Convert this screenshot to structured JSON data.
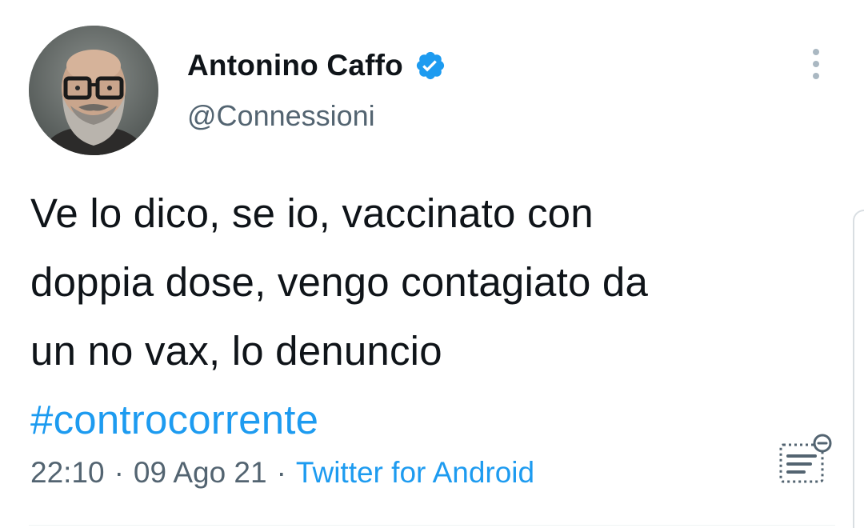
{
  "author": {
    "display_name": "Antonino Caffo",
    "handle": "@Connessioni",
    "verified": true,
    "avatar_icon": "bearded-man-with-glasses-avatar"
  },
  "tweet": {
    "text_lines": [
      "Ve lo dico, se io, vaccinato con",
      "doppia dose, vengo contagiato da",
      "un no vax, lo denuncio"
    ],
    "hashtag": "#controcorrente"
  },
  "meta": {
    "time": "22:10",
    "separator": "·",
    "date": "09 Ago 21",
    "source": "Twitter for Android"
  },
  "icons": {
    "verified": "verified-badge-icon",
    "more": "more-options-icon",
    "analytics": "tweet-analytics-icon"
  },
  "colors": {
    "link": "#1d9bf0",
    "secondary_text": "#536471",
    "primary_text": "#0f1419"
  }
}
